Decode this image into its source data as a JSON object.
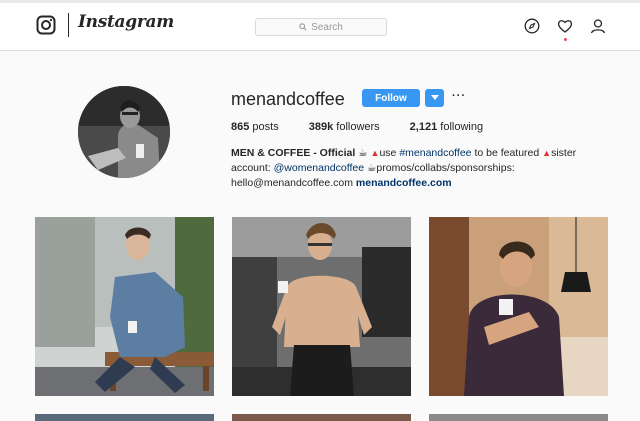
{
  "header": {
    "brand": "Instagram",
    "search_placeholder": "Search"
  },
  "profile": {
    "username": "menandcoffee",
    "follow_label": "Follow",
    "more_label": "···",
    "stats": [
      {
        "value": "865",
        "label": "posts"
      },
      {
        "value": "389k",
        "label": "followers"
      },
      {
        "value": "2,121",
        "label": "following"
      }
    ],
    "bio": {
      "name": "MEN & COFFEE - Official",
      "text1": "use",
      "hashtag": "#menandcoffee",
      "text2": "to be featured",
      "text3": "sister account:",
      "mention": "@womenandcoffee",
      "text4": "promos/collabs/sponsorships:",
      "email": "hello@menandcoffee.com",
      "website": "menandcoffee.com"
    }
  },
  "colors": {
    "accent": "#3897f0",
    "notification": "#ed4956",
    "link": "#003569"
  },
  "icons": [
    "instagram-logo-icon",
    "search-icon",
    "explore-compass-icon",
    "heart-icon",
    "profile-icon",
    "chevron-down-icon",
    "coffee-icon"
  ]
}
